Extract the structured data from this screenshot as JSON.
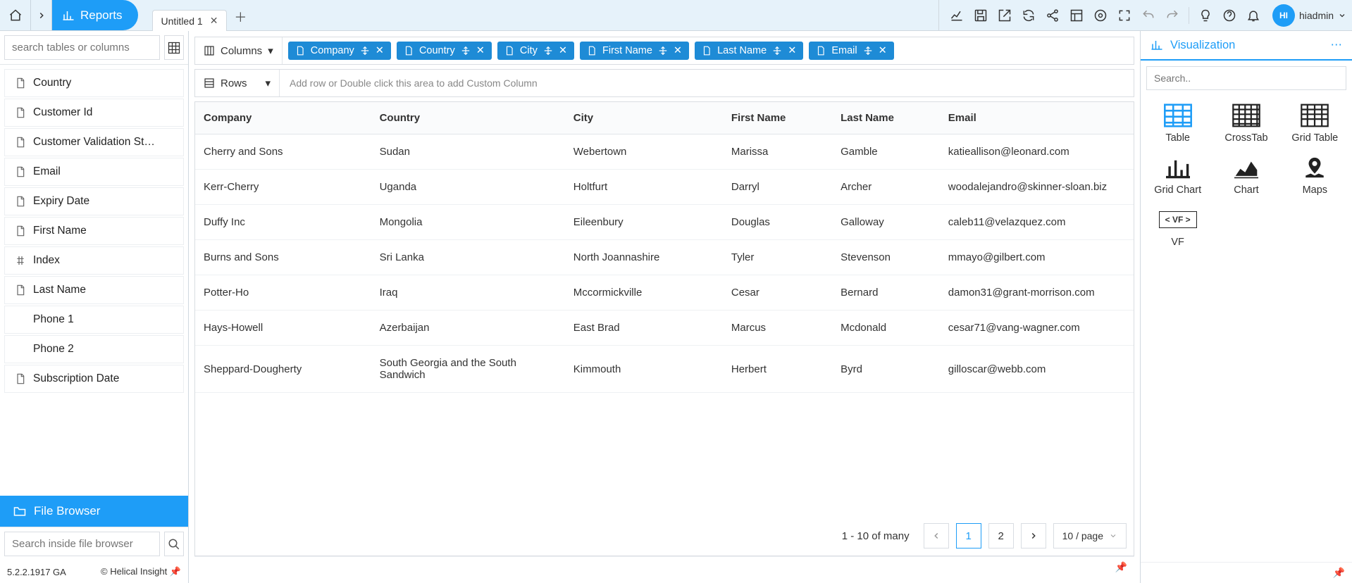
{
  "topbar": {
    "reports_label": "Reports",
    "tab_title": "Untitled 1",
    "user_name": "hiadmin",
    "user_initials": "HI"
  },
  "sidebar": {
    "search_placeholder": "search tables or columns",
    "fields": [
      "Country",
      "Customer Id",
      "Customer Validation St…",
      "Email",
      "Expiry Date",
      "First Name",
      "Index",
      "Last Name",
      "Phone 1",
      "Phone 2",
      "Subscription Date"
    ],
    "file_browser_label": "File Browser",
    "fb_search_placeholder": "Search inside file browser",
    "version": "5.2.2.1917 GA",
    "copyright": "Helical Insight"
  },
  "shelves": {
    "columns_label": "Columns",
    "rows_label": "Rows",
    "rows_placeholder": "Add row or Double click this area to add Custom Column",
    "chips": [
      "Company",
      "Country",
      "City",
      "First Name",
      "Last Name",
      "Email"
    ]
  },
  "table": {
    "headers": [
      "Company",
      "Country",
      "City",
      "First Name",
      "Last Name",
      "Email"
    ],
    "rows": [
      [
        "Cherry and Sons",
        "Sudan",
        "Webertown",
        "Marissa",
        "Gamble",
        "katieallison@leonard.com"
      ],
      [
        "Kerr-Cherry",
        "Uganda",
        "Holtfurt",
        "Darryl",
        "Archer",
        "woodalejandro@skinner-sloan.biz"
      ],
      [
        "Duffy Inc",
        "Mongolia",
        "Eileenbury",
        "Douglas",
        "Galloway",
        "caleb11@velazquez.com"
      ],
      [
        "Burns and Sons",
        "Sri Lanka",
        "North Joannashire",
        "Tyler",
        "Stevenson",
        "mmayo@gilbert.com"
      ],
      [
        "Potter-Ho",
        "Iraq",
        "Mccormickville",
        "Cesar",
        "Bernard",
        "damon31@grant-morrison.com"
      ],
      [
        "Hays-Howell",
        "Azerbaijan",
        "East Brad",
        "Marcus",
        "Mcdonald",
        "cesar71@vang-wagner.com"
      ],
      [
        "Sheppard-Dougherty",
        "South Georgia and the South Sandwich",
        "Kimmouth",
        "Herbert",
        "Byrd",
        "gilloscar@webb.com"
      ]
    ]
  },
  "pagination": {
    "info": "1 - 10 of many",
    "page1": "1",
    "page2": "2",
    "per_page": "10 / page"
  },
  "rightpanel": {
    "title": "Visualization",
    "search_placeholder": "Search..",
    "items": [
      "Table",
      "CrossTab",
      "Grid Table",
      "Grid Chart",
      "Chart",
      "Maps",
      "VF"
    ]
  }
}
